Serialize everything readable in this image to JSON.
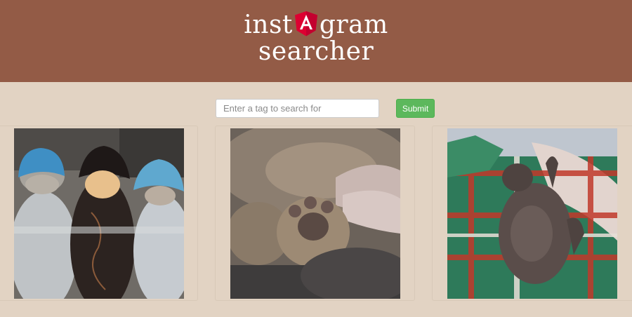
{
  "header": {
    "title_before_logo": "inst",
    "title_after_logo": "gram",
    "subtitle": "searcher",
    "logo_icon": "angular-shield-icon",
    "background": "#935b46"
  },
  "search": {
    "placeholder": "Enter a tag to search for",
    "value": "",
    "submit_label": "Submit",
    "submit_color": "#5cb85c"
  },
  "results": [
    {
      "icon": "photo-kittens-in-knit-hats"
    },
    {
      "icon": "photo-sleeping-kitten-paw"
    },
    {
      "icon": "photo-kitten-on-plaid-blanket"
    }
  ],
  "colors": {
    "page_background": "#e2d3c3"
  }
}
